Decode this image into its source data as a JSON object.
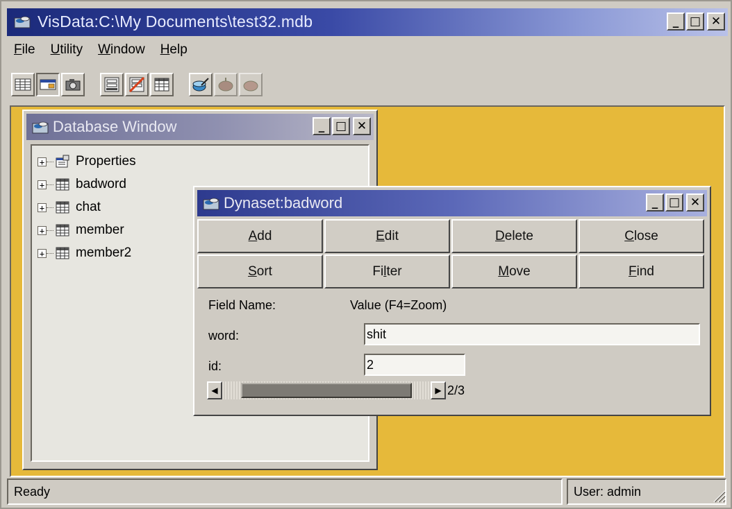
{
  "app": {
    "title": "VisData:C:\\My Documents\\test32.mdb",
    "window_buttons": {
      "minimize": "_",
      "maximize": "□",
      "close": "✕"
    }
  },
  "menu": [
    {
      "label": "File",
      "accel": "F",
      "rest": "ile"
    },
    {
      "label": "Utility",
      "accel": "U",
      "rest": "tility"
    },
    {
      "label": "Window",
      "accel": "W",
      "rest": "indow"
    },
    {
      "label": "Help",
      "accel": "H",
      "rest": "elp"
    }
  ],
  "toolbar": {
    "groups": [
      [
        "table-type-icon",
        "dynaset-type-icon",
        "snapshot-type-icon"
      ],
      [
        "data-control-form-icon",
        "no-data-control-form-icon",
        "dbgrid-form-icon"
      ],
      [
        "begin-transaction-icon",
        "commit-icon",
        "rollback-icon"
      ]
    ]
  },
  "database_window": {
    "title": "Database Window",
    "items": [
      {
        "label": "Properties",
        "icon": "properties-icon",
        "expander": "+"
      },
      {
        "label": "badword",
        "icon": "table-icon",
        "expander": "+"
      },
      {
        "label": "chat",
        "icon": "table-icon",
        "expander": "+"
      },
      {
        "label": "member",
        "icon": "table-icon",
        "expander": "+"
      },
      {
        "label": "member2",
        "icon": "table-icon",
        "expander": "+"
      }
    ]
  },
  "dynaset_window": {
    "title": "Dynaset:badword",
    "buttons_row1": [
      {
        "label": "Add",
        "accel_index": 0
      },
      {
        "label": "Edit",
        "accel_index": 0
      },
      {
        "label": "Delete",
        "accel_index": 0
      },
      {
        "label": "Close",
        "accel_index": 0
      }
    ],
    "buttons_row2": [
      {
        "label": "Sort",
        "accel_index": 0
      },
      {
        "label": "Filter",
        "accel_index": 2
      },
      {
        "label": "Move",
        "accel_index": 0
      },
      {
        "label": "Find",
        "accel_index": 0
      }
    ],
    "field_name_header": "Field Name:",
    "value_header": "Value (F4=Zoom)",
    "fields": [
      {
        "label": "word:",
        "value": "shit"
      },
      {
        "label": "id:",
        "value": "2"
      }
    ],
    "scroll": {
      "left_arrow": "◀",
      "right_arrow": "▶",
      "position_fraction": 0.5
    },
    "record_position": "2/3"
  },
  "status": {
    "left": "Ready",
    "right": "User: admin"
  },
  "colors": {
    "workspace": "#e6b93a",
    "title_active": "#1b2a7a",
    "chrome": "#cfcbc3"
  }
}
